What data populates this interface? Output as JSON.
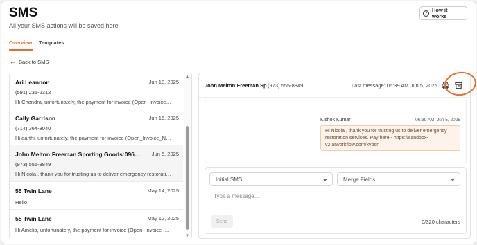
{
  "page": {
    "title": "SMS",
    "subtitle": "All your SMS actions will be saved here",
    "help_button": "How it works"
  },
  "tabs": [
    {
      "label": "Overview",
      "active": true
    },
    {
      "label": "Templates",
      "active": false
    }
  ],
  "back_link": "Back to SMS",
  "conversations": [
    {
      "name": "Ari Leannon",
      "date": "Jun 18, 2025",
      "phone": "(591) 231-2312",
      "preview": "Hi Chandra, unfortunately, the payment for invoice (Open_Invoice_N..."
    },
    {
      "name": "Cally Garrison",
      "date": "Jun 16, 2025",
      "phone": "(714) 364-8040",
      "preview": "Hi aarthi, unfortunately, the payment for invoice (Open_Invoice_Num..."
    },
    {
      "name": "John Melton:Freeman Sporting Goods:0969 Oc...",
      "date": "Jun 5, 2025",
      "phone": "(973) 555-8849",
      "preview": "Hi Nicola , thank you for trusting us to deliver emergency restoration..."
    },
    {
      "name": "55 Twin Lane",
      "date": "May 14, 2025",
      "phone": "",
      "preview": "Hello"
    },
    {
      "name": "55 Twin Lane",
      "date": "May 12, 2025",
      "phone": "",
      "preview": "Hi Amelia, unfortunately, the payment for invoice (Open_Invoice_Num..."
    }
  ],
  "chat": {
    "contact": "John Melton:Freeman Sp...",
    "phone": "(973) 555-8849",
    "last_message": "Last message: 06:39 AM Jun 5, 2025",
    "message": {
      "sender": "Kishok Kumar",
      "time": "06:39 AM, Jun 5, 2025",
      "text": "Hi Nicola , thank you for trusting us to deliver emergency restoration services. Pay here - https://sandbox-v2.arworkflow.com/xvb6n"
    },
    "compose": {
      "template_select": "Initial SMS",
      "merge_select": "Merge Fields",
      "placeholder": "Type a message...",
      "send": "Send",
      "char_count": "0/320 characters"
    }
  },
  "colors": {
    "accent": "#e0702e",
    "bubble_bg": "#fdf3ea",
    "bubble_border": "#f2cba7"
  },
  "icons": [
    "help-circle-icon",
    "arrow-left-icon",
    "print-icon",
    "archive-icon",
    "chevron-down-icon",
    "chevron-up-icon"
  ]
}
